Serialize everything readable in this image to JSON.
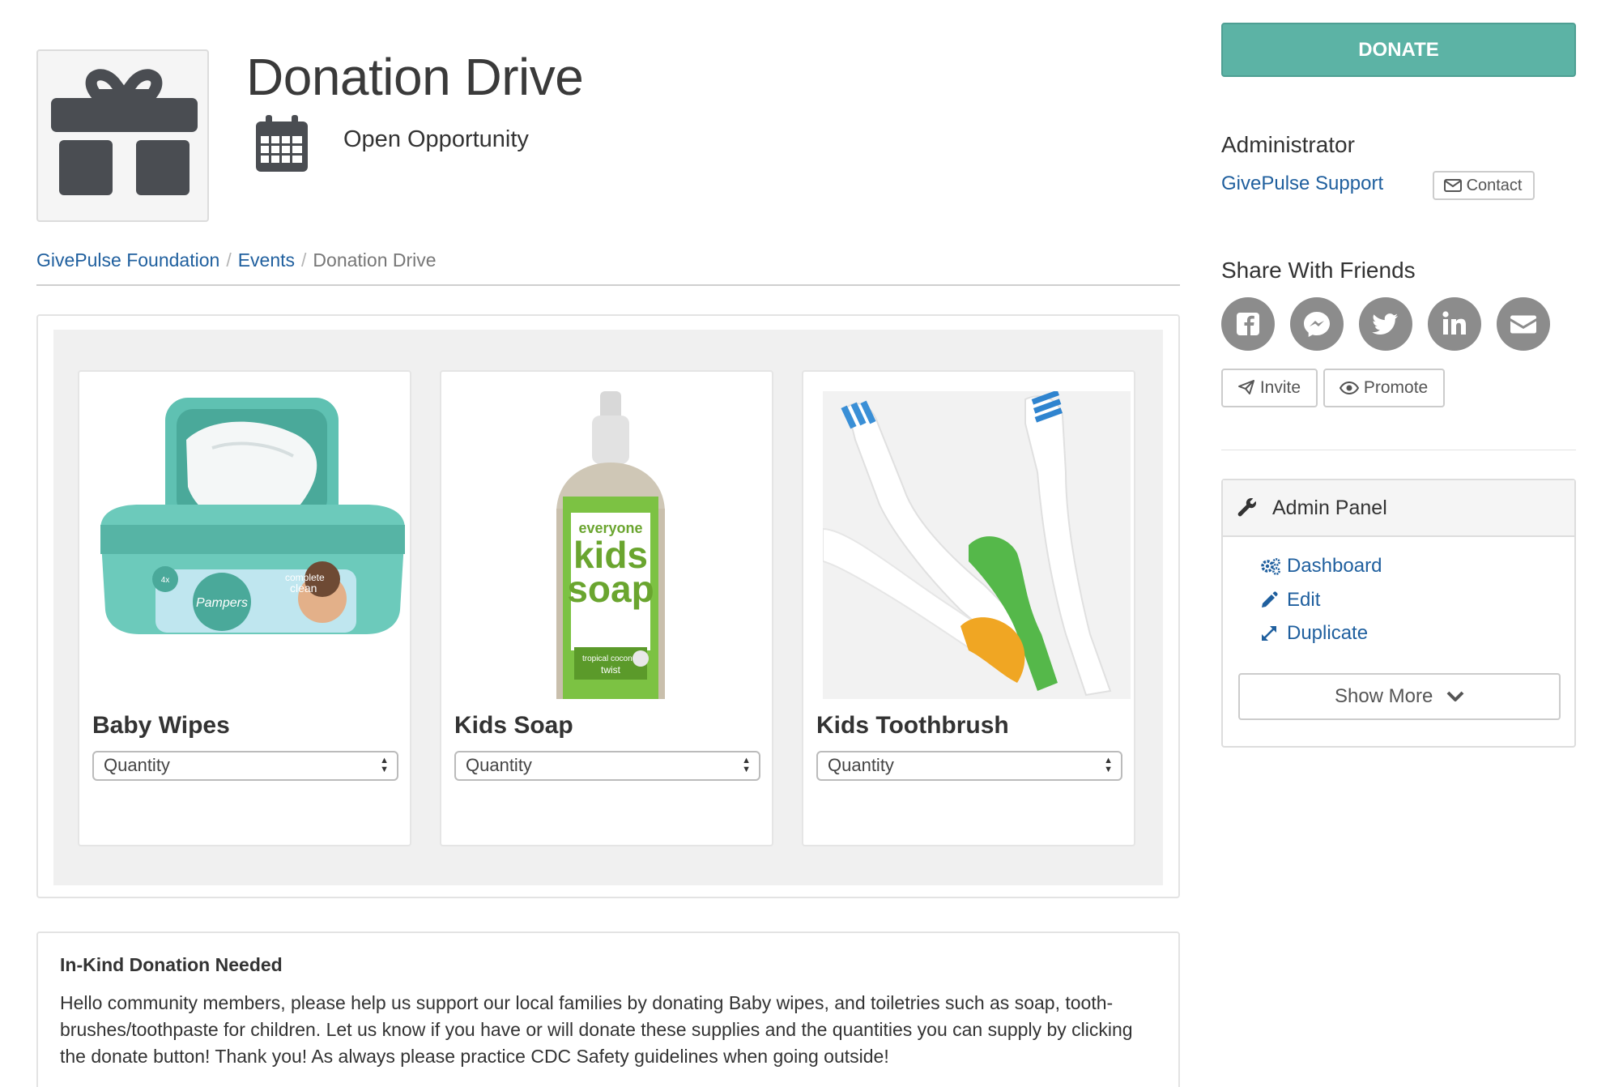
{
  "header": {
    "title": "Donation Drive",
    "subtitle": "Open Opportunity"
  },
  "breadcrumb": {
    "items": [
      "GivePulse Foundation",
      "Events"
    ],
    "separator": "/",
    "current": "Donation Drive"
  },
  "products": [
    {
      "name": "Baby Wipes",
      "quantity_placeholder": "Quantity"
    },
    {
      "name": "Kids Soap",
      "quantity_placeholder": "Quantity"
    },
    {
      "name": "Kids Toothbrush",
      "quantity_placeholder": "Quantity"
    }
  ],
  "description": {
    "heading": "In-Kind Donation Needed",
    "body": "Hello community members, please help us support our local families by donating Baby wipes, and toiletries such as soap, tooth-brushes/toothpaste for children. Let us know if you have or will donate these supplies and the quantities you can supply by clicking the donate button! Thank you! As always please practice CDC Safety guidelines when going outside!"
  },
  "sidebar": {
    "donate_label": "DONATE",
    "administrator_label": "Administrator",
    "administrator_name": "GivePulse Support",
    "contact_label": "Contact",
    "share_label": "Share With Friends",
    "share_icons": [
      "facebook-icon",
      "messenger-icon",
      "twitter-icon",
      "linkedin-icon",
      "email-icon"
    ],
    "invite_label": "Invite",
    "promote_label": "Promote",
    "admin_panel": {
      "title": "Admin Panel",
      "links": [
        "Dashboard",
        "Edit",
        "Duplicate"
      ],
      "show_more_label": "Show More"
    }
  },
  "colors": {
    "accent": "#5cb3a5",
    "link": "#1f5f9e",
    "icon_gray": "#8c8c8c",
    "text": "#333333"
  }
}
